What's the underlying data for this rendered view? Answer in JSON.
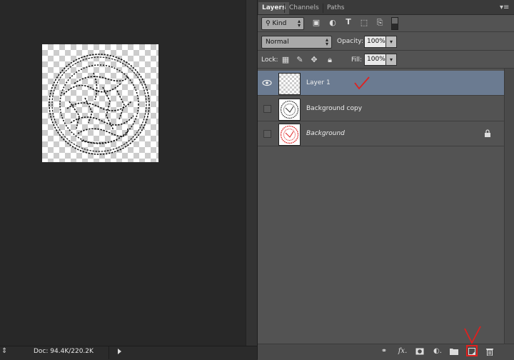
{
  "panel": {
    "tabs": [
      {
        "label": "Layers",
        "active": true
      },
      {
        "label": "Channels",
        "active": false
      },
      {
        "label": "Paths",
        "active": false
      }
    ],
    "menu_icon": "panel-menu-icon"
  },
  "filter": {
    "kind_label": "Kind",
    "icons": [
      "pixel-filter-icon",
      "adjustment-filter-icon",
      "type-filter-icon",
      "shape-filter-icon",
      "smart-object-filter-icon",
      "filter-toggle-icon"
    ]
  },
  "blend": {
    "mode": "Normal",
    "opacity_label": "Opacity:",
    "opacity_value": "100%"
  },
  "lock": {
    "label": "Lock:",
    "icons": [
      "lock-transparent-icon",
      "lock-image-icon",
      "lock-position-icon",
      "lock-all-icon"
    ],
    "fill_label": "Fill:",
    "fill_value": "100%"
  },
  "layers": [
    {
      "name": "Layer 1",
      "visible": true,
      "selected": true,
      "thumb": "transparent",
      "locked": false,
      "italic": false
    },
    {
      "name": "Background copy",
      "visible": false,
      "selected": false,
      "thumb": "stamp-black",
      "locked": false,
      "italic": false
    },
    {
      "name": "Background",
      "visible": false,
      "selected": false,
      "thumb": "stamp-red",
      "locked": true,
      "italic": true
    }
  ],
  "status": {
    "doc_info": "Doc: 94.4K/220.2K"
  },
  "footer": {
    "icons": [
      "link-layers-icon",
      "fx-icon",
      "add-mask-icon",
      "adjustment-layer-icon",
      "new-group-icon",
      "new-layer-icon",
      "delete-layer-icon"
    ]
  },
  "colors": {
    "panel_bg": "#535353",
    "selected_row": "#6b7b91",
    "annotation_red": "#e0201e",
    "workspace_bg": "#282828"
  }
}
